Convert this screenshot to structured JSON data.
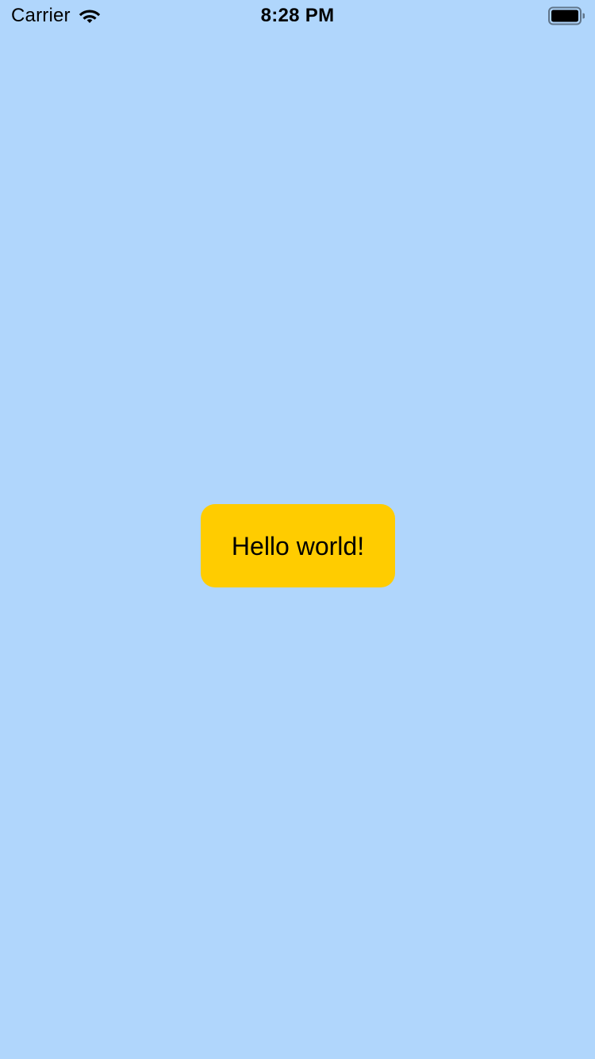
{
  "status_bar": {
    "carrier": "Carrier",
    "time": "8:28 PM",
    "icons": {
      "wifi": "wifi-icon",
      "battery": "battery-icon"
    }
  },
  "main": {
    "button_label": "Hello world!"
  },
  "colors": {
    "background": "#B0D6FC",
    "button": "#FFCC00",
    "text": "#000000"
  }
}
